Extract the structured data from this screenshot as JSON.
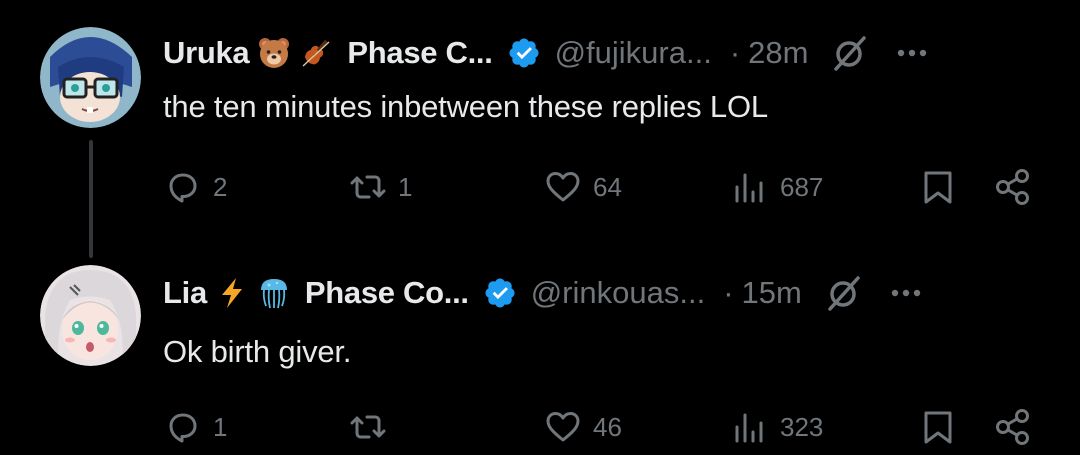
{
  "tweets": [
    {
      "display_name": "Uruka",
      "name_emojis": [
        "bear-face-emoji",
        "violin-emoji"
      ],
      "org_name": "Phase C...",
      "handle": "@fujikura...",
      "separator": "·",
      "time": "28m",
      "text": "the ten minutes inbetween these replies LOL",
      "replies": "2",
      "retweets": "1",
      "likes": "64",
      "views": "687"
    },
    {
      "display_name": "Lia",
      "name_emojis": [
        "lightning-emoji",
        "jellyfish-emoji"
      ],
      "org_name": "Phase Co...",
      "handle": "@rinkouas...",
      "separator": "·",
      "time": "15m",
      "text": "Ok birth giver.",
      "replies": "1",
      "retweets": "",
      "likes": "46",
      "views": "323"
    }
  ],
  "colors": {
    "background": "#000000",
    "text_primary": "#e7e9ea",
    "text_secondary": "#71767b",
    "verified": "#1d9bf0",
    "thread_line": "#333639"
  }
}
